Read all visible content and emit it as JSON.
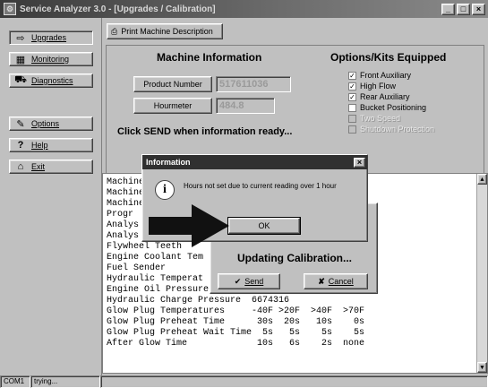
{
  "window": {
    "title": "Service Analyzer 3.0 - [Upgrades / Calibration]",
    "minimize": "_",
    "restore": "□",
    "close": "×"
  },
  "nav": {
    "upgrades": "Upgrades",
    "monitoring": "Monitoring",
    "diagnostics": "Diagnostics",
    "options": "Options",
    "help": "Help",
    "exit": "Exit"
  },
  "toolbar": {
    "print_label": "Print Machine Description"
  },
  "machine_info": {
    "heading": "Machine Information",
    "product_number_label": "Product Number",
    "product_number_value": "517611036",
    "hourmeter_label": "Hourmeter",
    "hourmeter_value": "484.8",
    "send_prompt": "Click SEND when information ready..."
  },
  "options_kits": {
    "heading": "Options/Kits Equipped",
    "items": [
      {
        "label": "Front Auxiliary",
        "checked": true,
        "enabled": true
      },
      {
        "label": "High Flow",
        "checked": true,
        "enabled": true
      },
      {
        "label": "Rear Auxiliary",
        "checked": true,
        "enabled": true
      },
      {
        "label": "Bucket Positioning",
        "checked": false,
        "enabled": true
      },
      {
        "label": "Two Speed",
        "checked": false,
        "enabled": false
      },
      {
        "label": "Shutdown Protection",
        "checked": false,
        "enabled": false
      }
    ]
  },
  "console": {
    "rows": [
      "Machine",
      "Machine",
      "Machine",
      "Progr",
      "Analys",
      "Analys",
      "Flywheel Teeth",
      "Engine Coolant Tem",
      "Fuel Sender",
      "Hydraulic Temperat",
      "Engine Oil Pressure        6674315",
      "Hydraulic Charge Pressure  6674316",
      "Glow Plug Temperatures     -40F >20F  >40F  >70F",
      "Glow Plug Preheat Time      30s  20s   10s    0s",
      "Glow Plug Preheat Wait Time  5s   5s    5s    5s",
      "After Glow Time             10s   6s    2s  none"
    ]
  },
  "update_dialog": {
    "title": "Updating Calibration...",
    "send_label": "Send",
    "cancel_label": "Cancel"
  },
  "info_dialog": {
    "title": "Information",
    "message": "Hours not set due to current reading over 1 hour",
    "ok_label": "OK",
    "close": "×"
  },
  "status_bar": {
    "port": "COM1",
    "state": "trying..."
  },
  "colors": {
    "face": "#c0c0c0",
    "title_bar": "#303030",
    "arrow": "#111111"
  }
}
